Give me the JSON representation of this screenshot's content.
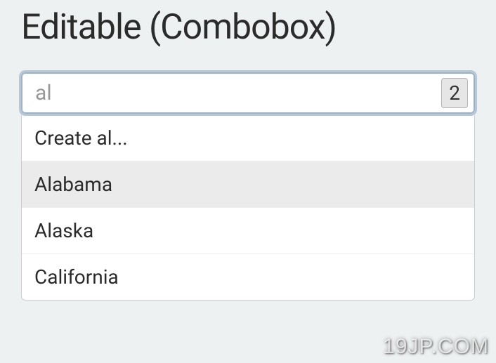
{
  "heading": "Editable (Combobox)",
  "combobox": {
    "input_value": "al",
    "placeholder": "",
    "badge_count": "2",
    "options": [
      {
        "label": "Create al...",
        "highlighted": false
      },
      {
        "label": "Alabama",
        "highlighted": true
      },
      {
        "label": "Alaska",
        "highlighted": false
      },
      {
        "label": "California",
        "highlighted": false
      }
    ]
  },
  "watermark": "19JP.COM"
}
